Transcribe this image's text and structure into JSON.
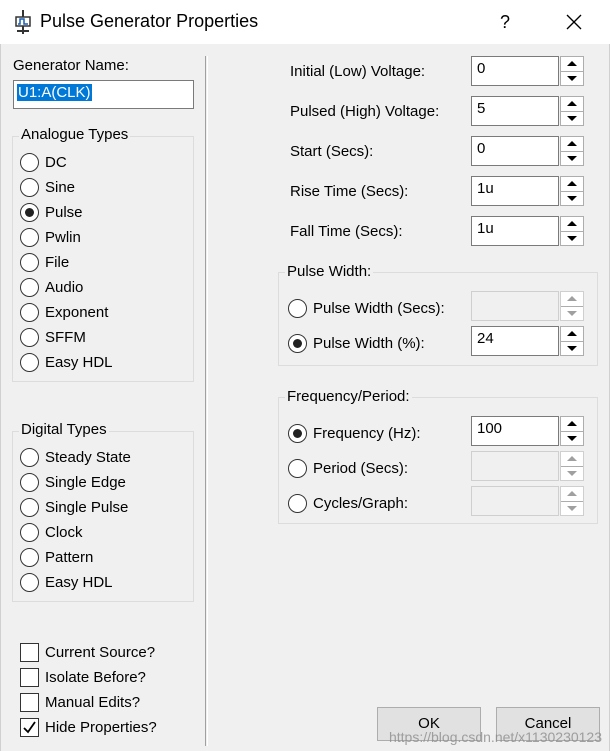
{
  "window": {
    "title": "Pulse Generator Properties",
    "help_label": "?",
    "close_icon": "close-icon",
    "app_icon": "pulse-generator-icon"
  },
  "generator_name": {
    "label": "Generator Name:",
    "value": "U1:A(CLK)"
  },
  "analogue_types": {
    "title": "Analogue Types",
    "selected": "Pulse",
    "items": [
      "DC",
      "Sine",
      "Pulse",
      "Pwlin",
      "File",
      "Audio",
      "Exponent",
      "SFFM",
      "Easy HDL"
    ]
  },
  "digital_types": {
    "title": "Digital Types",
    "items": [
      "Steady State",
      "Single Edge",
      "Single Pulse",
      "Clock",
      "Pattern",
      "Easy HDL"
    ]
  },
  "options": {
    "items": [
      {
        "label": "Current Source?",
        "checked": false
      },
      {
        "label": "Isolate Before?",
        "checked": false
      },
      {
        "label": "Manual Edits?",
        "checked": false
      },
      {
        "label": "Hide Properties?",
        "checked": true
      }
    ]
  },
  "params": {
    "initial_voltage": {
      "label": "Initial (Low) Voltage:",
      "value": "0"
    },
    "pulsed_voltage": {
      "label": "Pulsed (High) Voltage:",
      "value": "5"
    },
    "start": {
      "label": "Start (Secs):",
      "value": "0"
    },
    "rise_time": {
      "label": "Rise Time (Secs):",
      "value": "1u"
    },
    "fall_time": {
      "label": "Fall Time (Secs):",
      "value": "1u"
    }
  },
  "pulse_width": {
    "title": "Pulse Width:",
    "secs_label": "Pulse Width (Secs):",
    "secs_value": "",
    "percent_label": "Pulse Width (%):",
    "percent_value": "24",
    "selected": "percent"
  },
  "frequency_period": {
    "title": "Frequency/Period:",
    "frequency_label": "Frequency (Hz):",
    "frequency_value": "100",
    "period_label": "Period (Secs):",
    "period_value": "",
    "cycles_label": "Cycles/Graph:",
    "cycles_value": "",
    "selected": "frequency"
  },
  "buttons": {
    "ok": "OK",
    "cancel": "Cancel"
  },
  "watermark": "https://blog.csdn.net/x1130230123"
}
